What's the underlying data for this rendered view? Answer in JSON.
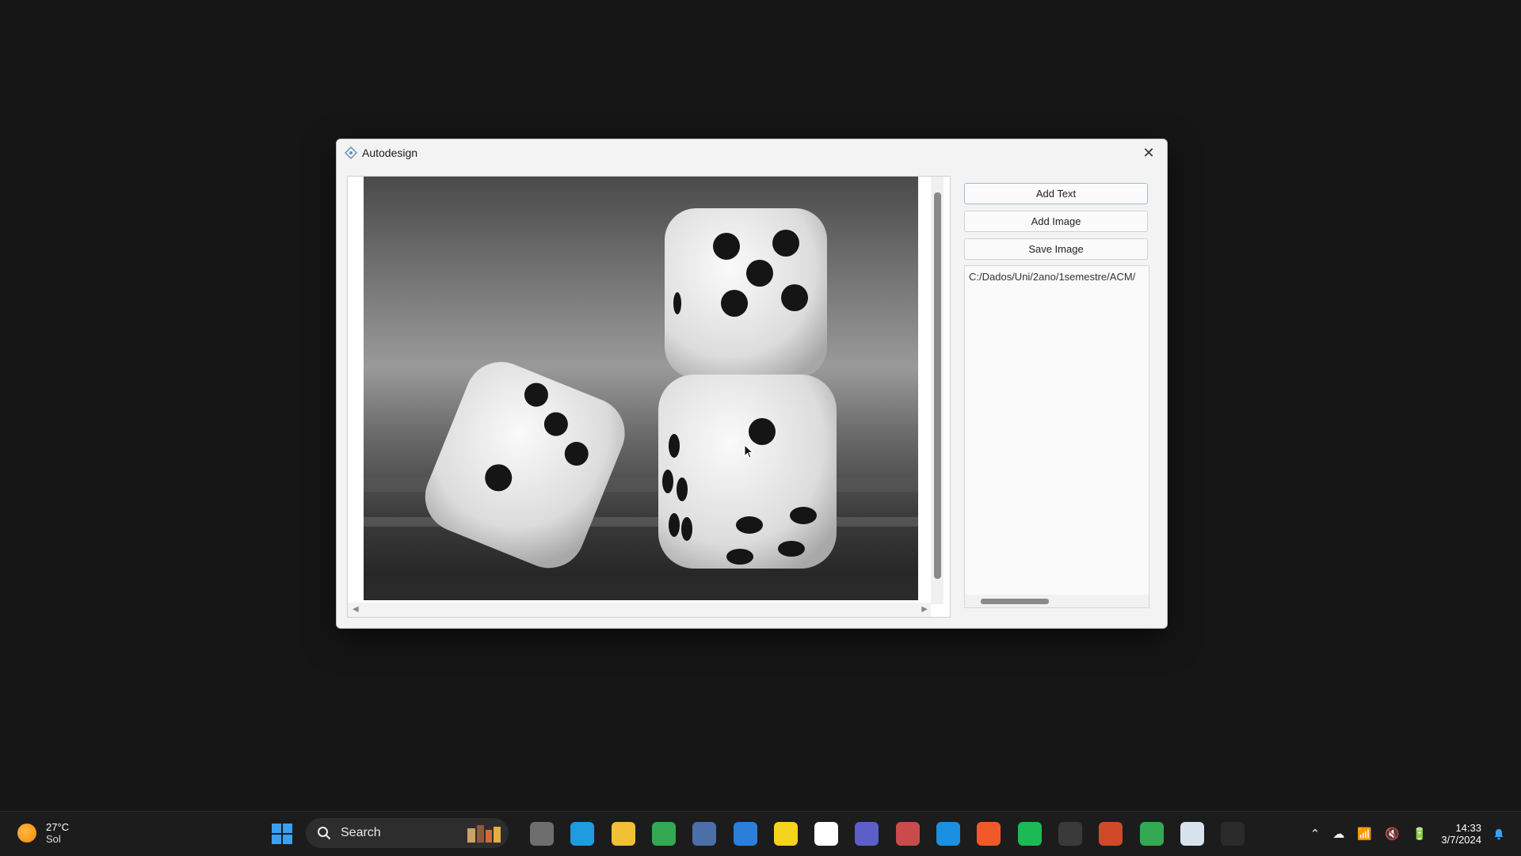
{
  "window": {
    "title": "Autodesign",
    "close_glyph": "✕"
  },
  "sidepanel": {
    "add_text_label": "Add Text",
    "add_image_label": "Add Image",
    "save_image_label": "Save Image",
    "list_items": [
      "C:/Dados/Uni/2ano/1semestre/ACM/"
    ]
  },
  "canvas": {
    "image_description_icon": "dice-photo"
  },
  "taskbar": {
    "weather_temp": "27°C",
    "weather_desc": "Sol",
    "search_placeholder": "Search",
    "clock_time": "14:33",
    "clock_date": "3/7/2024",
    "apps": [
      {
        "name": "task-view-icon",
        "color": "#6e6e6e"
      },
      {
        "name": "edge-icon",
        "color": "#1f9be0"
      },
      {
        "name": "file-explorer-icon",
        "color": "#f2c037"
      },
      {
        "name": "chrome-icon",
        "color": "#34a853"
      },
      {
        "name": "calculator-icon",
        "color": "#4d6fa8"
      },
      {
        "name": "microsoft-store-icon",
        "color": "#2b7fd8"
      },
      {
        "name": "sticky-notes-icon",
        "color": "#f7d21e"
      },
      {
        "name": "notion-icon",
        "color": "#ffffff"
      },
      {
        "name": "teams-icon",
        "color": "#5b5fc7"
      },
      {
        "name": "snipping-tool-icon",
        "color": "#c94b4b"
      },
      {
        "name": "vscode-icon",
        "color": "#1b8fe0"
      },
      {
        "name": "brave-icon",
        "color": "#f05a28"
      },
      {
        "name": "spotify-icon",
        "color": "#1db954"
      },
      {
        "name": "terminal-icon",
        "color": "#3a3a3a"
      },
      {
        "name": "powerpoint-icon",
        "color": "#d04a2a"
      },
      {
        "name": "chrome-profile-icon",
        "color": "#34a853"
      },
      {
        "name": "acm-app-icon",
        "color": "#d9e3ee"
      },
      {
        "name": "obs-icon",
        "color": "#2b2b2b"
      }
    ]
  }
}
